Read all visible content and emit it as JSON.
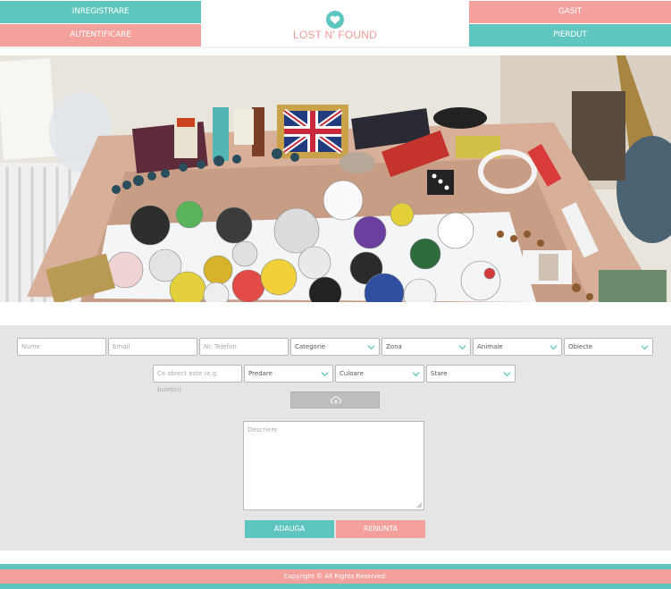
{
  "header": {
    "register_label": "INREGISTRARE",
    "login_label": "AUTENTIFICARE",
    "found_label": "GASIT",
    "lost_label": "PIERDUT",
    "logo_text": "LOST N' FOUND",
    "logo_icon": "heart-icon"
  },
  "hero": {
    "image": "photo of found items: badges, passport, beads, dice, bottles on a table"
  },
  "form": {
    "name_placeholder": "Nume",
    "email_placeholder": "Email",
    "phone_placeholder": "Nr. Telefon",
    "category_select": "Categorie",
    "zone_select": "Zona",
    "animals_select": "Animale",
    "objects_select": "Obiecte",
    "what_object_placeholder": "Ce obiect este (e.g. buletin)",
    "breed_select": "Predare",
    "color_select": "Culoare",
    "status_select": "Stare",
    "upload_icon": "cloud-upload-icon",
    "description_placeholder": "Descriere",
    "add_label": "ADAUGA",
    "cancel_label": "RENUNTA"
  },
  "footer": {
    "copyright": "Copyright © All Rights Reserved."
  },
  "colors": {
    "teal": "#5ec6bf",
    "pink": "#f4a19e",
    "form_bg": "#e5e5e5"
  }
}
